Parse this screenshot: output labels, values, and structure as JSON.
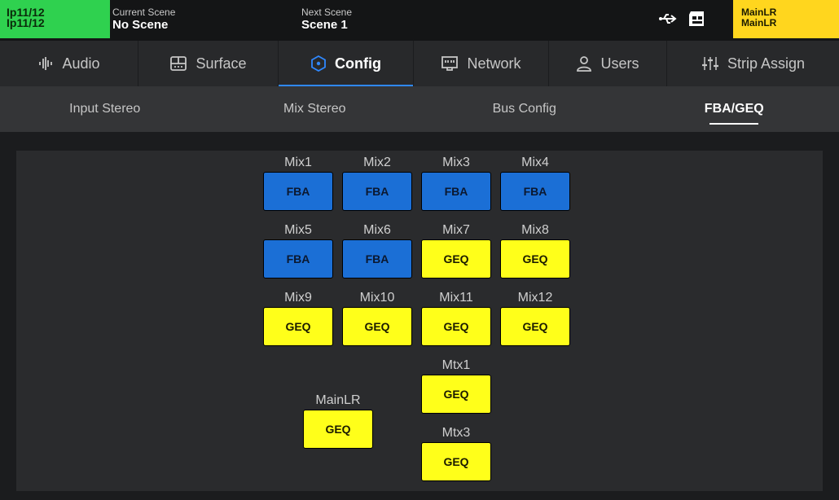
{
  "header": {
    "selected_channel": [
      "Ip11/12",
      "Ip11/12"
    ],
    "current_scene_label": "Current Scene",
    "current_scene_value": "No Scene",
    "next_scene_label": "Next Scene",
    "next_scene_value": "Scene 1",
    "main_badge": [
      "MainLR",
      "MainLR"
    ],
    "icons": [
      "usb-icon",
      "sd-card-icon"
    ]
  },
  "tabs": [
    {
      "label": "Audio",
      "icon": "audio-waveform-icon"
    },
    {
      "label": "Surface",
      "icon": "surface-icon"
    },
    {
      "label": "Config",
      "icon": "config-gear-icon",
      "active": true
    },
    {
      "label": "Network",
      "icon": "network-icon"
    },
    {
      "label": "Users",
      "icon": "user-icon"
    },
    {
      "label": "Strip Assign",
      "icon": "faders-icon"
    }
  ],
  "subtabs": [
    {
      "label": "Input Stereo"
    },
    {
      "label": "Mix Stereo"
    },
    {
      "label": "Bus Config"
    },
    {
      "label": "FBA/GEQ",
      "active": true
    }
  ],
  "buses": [
    {
      "name": "Mix1",
      "mode": "FBA"
    },
    {
      "name": "Mix2",
      "mode": "FBA"
    },
    {
      "name": "Mix3",
      "mode": "FBA"
    },
    {
      "name": "Mix4",
      "mode": "FBA"
    },
    {
      "name": "Mix5",
      "mode": "FBA"
    },
    {
      "name": "Mix6",
      "mode": "FBA"
    },
    {
      "name": "Mix7",
      "mode": "GEQ"
    },
    {
      "name": "Mix8",
      "mode": "GEQ"
    },
    {
      "name": "Mix9",
      "mode": "GEQ"
    },
    {
      "name": "Mix10",
      "mode": "GEQ"
    },
    {
      "name": "Mix11",
      "mode": "GEQ"
    },
    {
      "name": "Mix12",
      "mode": "GEQ"
    },
    {
      "name": "Mtx1",
      "mode": "GEQ"
    },
    {
      "name": "MainLR",
      "mode": "GEQ"
    },
    {
      "name": "Mtx3",
      "mode": "GEQ"
    }
  ],
  "colors": {
    "fba": "#1b6fd6",
    "geq": "#ffff1a",
    "selected_channel": "#2fd14f",
    "main_badge": "#ffd61e",
    "tab_accent": "#2f88ff"
  }
}
